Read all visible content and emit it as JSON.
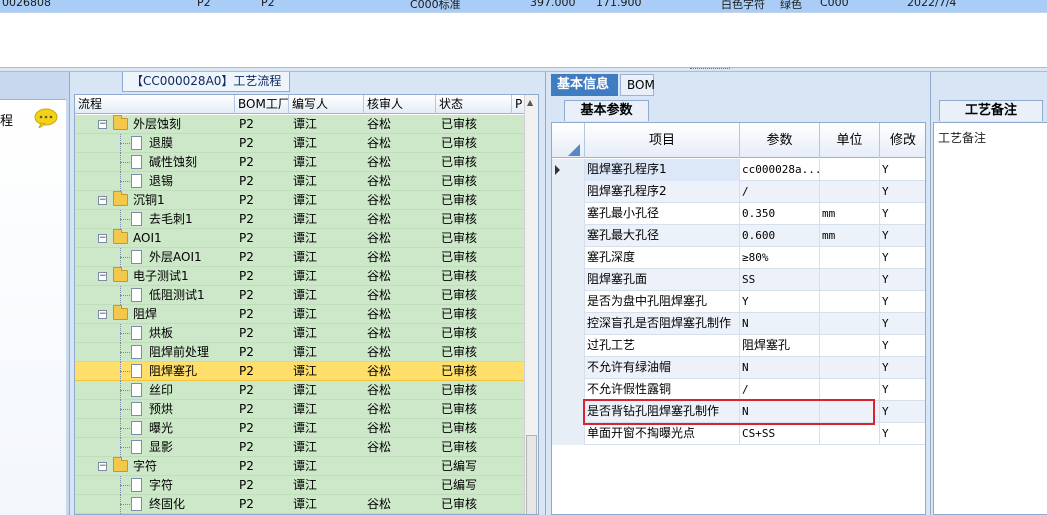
{
  "top_row": {
    "cells": [
      "0026808",
      "P2",
      "P2",
      "C000标准",
      "397.000",
      "171.900",
      "白色字符",
      "绿色",
      "C000",
      "2022/7/4"
    ]
  },
  "left_panel": {
    "label": "程"
  },
  "process_panel": {
    "title": "【CC000028A0】工艺流程",
    "columns": [
      "流程",
      "BOM工厂",
      "编写人",
      "核审人",
      "状态",
      "P"
    ],
    "rows": [
      {
        "name": "外层蚀刻",
        "factory": "P2",
        "author": "谭江",
        "reviewer": "谷松",
        "status": "已审核"
      },
      {
        "name": "退膜",
        "factory": "P2",
        "author": "谭江",
        "reviewer": "谷松",
        "status": "已审核"
      },
      {
        "name": "碱性蚀刻",
        "factory": "P2",
        "author": "谭江",
        "reviewer": "谷松",
        "status": "已审核"
      },
      {
        "name": "退锡",
        "factory": "P2",
        "author": "谭江",
        "reviewer": "谷松",
        "status": "已审核"
      },
      {
        "name": "沉铜1",
        "factory": "P2",
        "author": "谭江",
        "reviewer": "谷松",
        "status": "已审核"
      },
      {
        "name": "去毛刺1",
        "factory": "P2",
        "author": "谭江",
        "reviewer": "谷松",
        "status": "已审核"
      },
      {
        "name": "AOI1",
        "factory": "P2",
        "author": "谭江",
        "reviewer": "谷松",
        "status": "已审核"
      },
      {
        "name": "外层AOI1",
        "factory": "P2",
        "author": "谭江",
        "reviewer": "谷松",
        "status": "已审核"
      },
      {
        "name": "电子测试1",
        "factory": "P2",
        "author": "谭江",
        "reviewer": "谷松",
        "status": "已审核"
      },
      {
        "name": "低阻测试1",
        "factory": "P2",
        "author": "谭江",
        "reviewer": "谷松",
        "status": "已审核"
      },
      {
        "name": "阻焊",
        "factory": "P2",
        "author": "谭江",
        "reviewer": "谷松",
        "status": "已审核"
      },
      {
        "name": "烘板",
        "factory": "P2",
        "author": "谭江",
        "reviewer": "谷松",
        "status": "已审核"
      },
      {
        "name": "阻焊前处理",
        "factory": "P2",
        "author": "谭江",
        "reviewer": "谷松",
        "status": "已审核"
      },
      {
        "name": "阻焊塞孔",
        "factory": "P2",
        "author": "谭江",
        "reviewer": "谷松",
        "status": "已审核"
      },
      {
        "name": "丝印",
        "factory": "P2",
        "author": "谭江",
        "reviewer": "谷松",
        "status": "已审核"
      },
      {
        "name": "预烘",
        "factory": "P2",
        "author": "谭江",
        "reviewer": "谷松",
        "status": "已审核"
      },
      {
        "name": "曝光",
        "factory": "P2",
        "author": "谭江",
        "reviewer": "谷松",
        "status": "已审核"
      },
      {
        "name": "显影",
        "factory": "P2",
        "author": "谭江",
        "reviewer": "谷松",
        "status": "已审核"
      },
      {
        "name": "字符",
        "factory": "P2",
        "author": "谭江",
        "reviewer": "",
        "status": "已编写"
      },
      {
        "name": "字符",
        "factory": "P2",
        "author": "谭江",
        "reviewer": "",
        "status": "已编写"
      },
      {
        "name": "终固化",
        "factory": "P2",
        "author": "谭江",
        "reviewer": "谷松",
        "status": "已审核"
      }
    ]
  },
  "param_panel": {
    "tabs": [
      "基本信息",
      "BOM"
    ],
    "sub_tab": "基本参数",
    "columns": [
      "项目",
      "参数",
      "单位",
      "修改"
    ],
    "rows": [
      {
        "item": "阻焊塞孔程序1",
        "value": "cc000028a...",
        "unit": "",
        "mod": "Y"
      },
      {
        "item": "阻焊塞孔程序2",
        "value": "/",
        "unit": "",
        "mod": "Y"
      },
      {
        "item": "塞孔最小孔径",
        "value": "0.350",
        "unit": "mm",
        "mod": "Y"
      },
      {
        "item": "塞孔最大孔径",
        "value": "0.600",
        "unit": "mm",
        "mod": "Y"
      },
      {
        "item": "塞孔深度",
        "value": "≥80%",
        "unit": "",
        "mod": "Y"
      },
      {
        "item": "阻焊塞孔面",
        "value": "SS",
        "unit": "",
        "mod": "Y"
      },
      {
        "item": "是否为盘中孔阻焊塞孔",
        "value": "Y",
        "unit": "",
        "mod": "Y"
      },
      {
        "item": "控深盲孔是否阻焊塞孔制作",
        "value": "N",
        "unit": "",
        "mod": "Y"
      },
      {
        "item": "过孔工艺",
        "value": "阻焊塞孔",
        "unit": "",
        "mod": "Y"
      },
      {
        "item": "不允许有绿油帽",
        "value": "N",
        "unit": "",
        "mod": "Y"
      },
      {
        "item": "不允许假性露铜",
        "value": "/",
        "unit": "",
        "mod": "Y"
      },
      {
        "item": "是否背钻孔阻焊塞孔制作",
        "value": "N",
        "unit": "",
        "mod": "Y"
      },
      {
        "item": "单面开窗不掏曝光点",
        "value": "CS+SS",
        "unit": "",
        "mod": "Y"
      }
    ]
  },
  "note_panel": {
    "tab": "工艺备注",
    "label": "工艺备注"
  },
  "colors": {
    "row_green": "#cde8c9",
    "row_selected": "#ffde6a",
    "tab_active": "#3f7cc2",
    "highlight_box": "#d9232e"
  }
}
